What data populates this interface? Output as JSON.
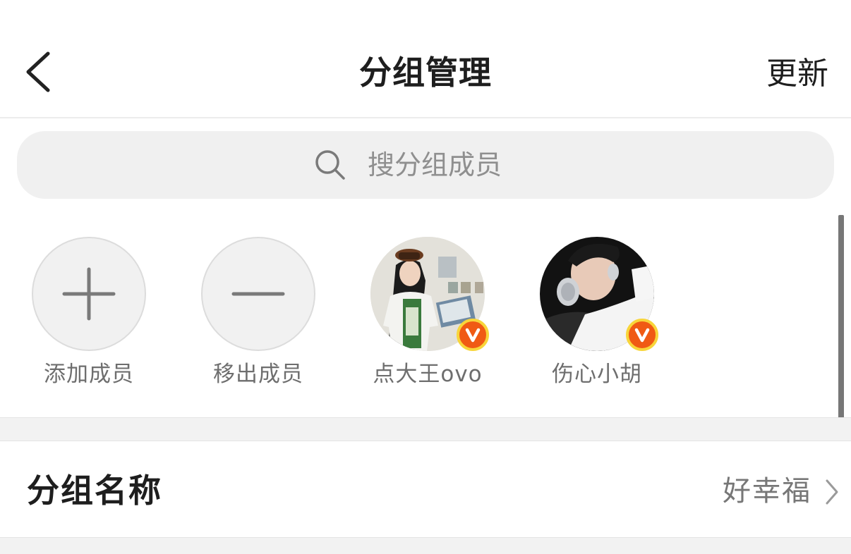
{
  "header": {
    "title": "分组管理",
    "back_icon": "chevron-left-icon",
    "update_label": "更新"
  },
  "search": {
    "icon": "search-icon",
    "placeholder": "搜分组成员"
  },
  "members": [
    {
      "label": "添加成员",
      "icon": "plus-icon"
    },
    {
      "label": "移出成员",
      "icon": "minus-icon"
    },
    {
      "label": "点大王ovo",
      "verified": true
    },
    {
      "label": "伤心小胡",
      "verified": true
    }
  ],
  "group_name": {
    "label": "分组名称",
    "value": "好幸福",
    "icon": "chevron-right-icon"
  },
  "colors": {
    "verified_badge": "#f05a14",
    "verified_ring": "#f8d53a",
    "search_bg": "#f0f0f0"
  }
}
